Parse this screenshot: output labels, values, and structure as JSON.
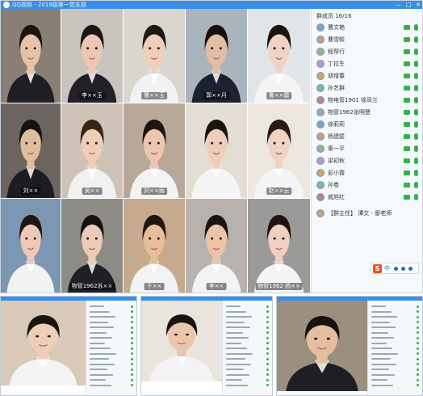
{
  "window": {
    "title": "QQ视频 - 2019级第一党支部",
    "controls": [
      "—",
      "□",
      "✕"
    ]
  },
  "video_tiles": [
    {
      "name": "",
      "bg": "#8a7f74",
      "shirt": "#1e1e24",
      "skin": "#e6c3a6",
      "hair": "#1b1410"
    },
    {
      "name": "李××玉",
      "bg": "#c9c4be",
      "shirt": "#202026",
      "skin": "#ecc8b3",
      "hair": "#1a1512"
    },
    {
      "name": "曹××玉",
      "bg": "#d9d6cf",
      "shirt": "#f2f2f2",
      "skin": "#efcfbc",
      "hair": "#201813"
    },
    {
      "name": "郭××月",
      "bg": "#a9b4bd",
      "shirt": "#1d2030",
      "skin": "#e2bea3",
      "hair": "#14110f"
    },
    {
      "name": "曹××霞",
      "bg": "#dfe5e8",
      "shirt": "#f4f4f4",
      "skin": "#f0d2c4",
      "hair": "#191410"
    },
    {
      "name": "刘××",
      "bg": "#6c655f",
      "shirt": "#1c1c22",
      "skin": "#e0bd9f",
      "hair": "#16120f"
    },
    {
      "name": "吴××",
      "bg": "#cfc3b7",
      "shirt": "#f1f1f1",
      "skin": "#f0cdb7",
      "hair": "#3a2416"
    },
    {
      "name": "刘××丽",
      "bg": "#b8a89a",
      "shirt": "#f3f3f3",
      "skin": "#ecc6ae",
      "hair": "#1c1511"
    },
    {
      "name": "",
      "bg": "#e4ddd3",
      "shirt": "#f5f5f5",
      "skin": "#efcdb9",
      "hair": "#1a1410"
    },
    {
      "name": "赵××云",
      "bg": "#ece7df",
      "shirt": "#f4f4f4",
      "skin": "#f1d3c2",
      "hair": "#2a1c14"
    },
    {
      "name": "",
      "bg": "#7d97b3",
      "shirt": "#f2f2f2",
      "skin": "#eec9b5",
      "hair": "#1d1612"
    },
    {
      "name": "物管1962苏××",
      "bg": "#8e8c86",
      "shirt": "#1f1f26",
      "skin": "#ecccb8",
      "hair": "#18120f"
    },
    {
      "name": "于××",
      "bg": "#c7a98d",
      "shirt": "#f3f3f3",
      "skin": "#e8bd9c",
      "hair": "#1f1611"
    },
    {
      "name": "李××",
      "bg": "#b7b2ad",
      "shirt": "#f3f3f3",
      "skin": "#ebc3a6",
      "hair": "#1b1511"
    },
    {
      "name": "物管1962 杨××",
      "bg": "#9a9b98",
      "shirt": "#f4f4f4",
      "skin": "#f0d0bf",
      "hair": "#1b1410"
    }
  ],
  "member_panel": {
    "header": "群成员 16/16",
    "members": [
      {
        "name": "曹文艳"
      },
      {
        "name": "曹雪蛟"
      },
      {
        "name": "程帮行"
      },
      {
        "name": "丁拉生"
      },
      {
        "name": "胡增春"
      },
      {
        "name": "孙艺群"
      },
      {
        "name": "物电管1901 徐凤兰"
      },
      {
        "name": "物管1962张明慧"
      },
      {
        "name": "徐莉莉"
      },
      {
        "name": "杨建壁"
      },
      {
        "name": "秦一平"
      },
      {
        "name": "梁初秋"
      },
      {
        "name": "彭小霞"
      },
      {
        "name": "孙卷"
      },
      {
        "name": "戚旭红"
      }
    ],
    "owner": "【群主任】 谭文 - 廖老师",
    "ime_label": "中"
  },
  "bottom_shots": [
    {
      "bg": "#d8c9b8",
      "shirt": "#f4f4f4",
      "skin": "#efcdb8",
      "hair": "#1b1511"
    },
    {
      "bg": "#e9e5de",
      "shirt": "#f3f3f3",
      "skin": "#ebc6ae",
      "hair": "#1a1410"
    },
    {
      "bg": "#9b8f80",
      "shirt": "#1e1e24",
      "skin": "#e4bf9f",
      "hair": "#16120e"
    }
  ],
  "colors": {
    "titlebar": "#3a8ee6",
    "online_green": "#33b14a",
    "ime_orange": "#e8531f"
  }
}
